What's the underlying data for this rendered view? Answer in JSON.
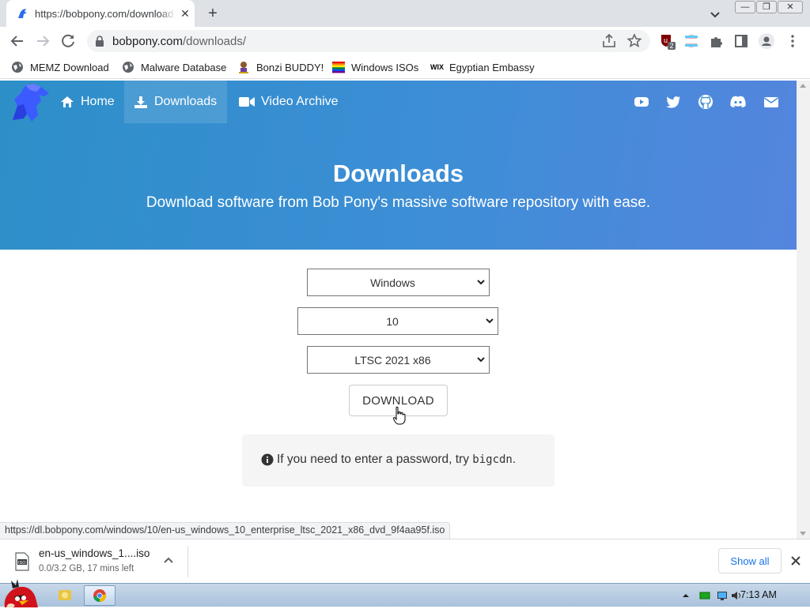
{
  "browser": {
    "tab_title": "https://bobpony.com/downloads/",
    "tab_close": "✕",
    "new_tab": "+",
    "url_host": "bobpony.com",
    "url_path": "/downloads/",
    "win_minimize": "—",
    "win_restore": "❐",
    "win_close": "✕",
    "extension_badge": "2"
  },
  "bookmarks": [
    {
      "label": "MEMZ Download",
      "icon": "globe-icon"
    },
    {
      "label": "Malware Database",
      "icon": "globe-icon"
    },
    {
      "label": "Bonzi BUDDY!",
      "icon": "bonzi-icon"
    },
    {
      "label": "Windows ISOs",
      "icon": "rainbow-flag-icon"
    },
    {
      "label": "Egyptian Embassy",
      "icon": "wix-icon"
    }
  ],
  "wix_label": "WIX",
  "site": {
    "nav": [
      {
        "label": "Home",
        "icon": "home-icon"
      },
      {
        "label": "Downloads",
        "icon": "download-icon"
      },
      {
        "label": "Video Archive",
        "icon": "video-icon"
      }
    ],
    "social": [
      "youtube-icon",
      "twitter-icon",
      "github-icon",
      "discord-icon",
      "mail-icon"
    ],
    "hero_title": "Downloads",
    "hero_subtitle": "Download software from Bob Pony's massive software repository with ease.",
    "selects": {
      "os": "Windows",
      "version": "10",
      "edition": "LTSC 2021 x86"
    },
    "download_label": "DOWNLOAD",
    "notice_text": "If you need to enter a password, try",
    "notice_code": "bigcdn",
    "notice_end": "."
  },
  "status_url": "https://dl.bobpony.com/windows/10/en-us_windows_10_enterprise_ltsc_2021_x86_dvd_9f4aa95f.iso",
  "download_shelf": {
    "file_name": "en-us_windows_1....iso",
    "progress": "0.0/3.2 GB, 17 mins left",
    "file_icon_label": "ISO",
    "show_all": "Show all"
  },
  "taskbar": {
    "clock": "7:13 AM"
  },
  "colors": {
    "hero_start": "#2d8fc8",
    "hero_end": "#5585de",
    "link_blue": "#1a73e8"
  }
}
